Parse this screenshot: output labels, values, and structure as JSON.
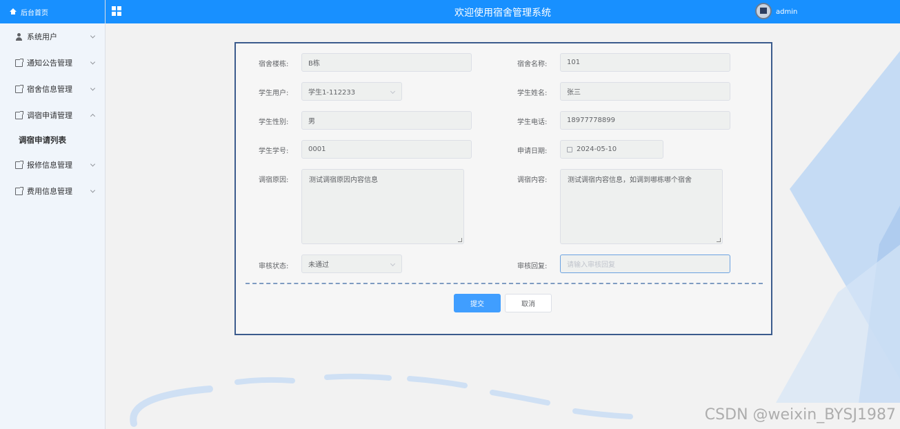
{
  "header": {
    "title": "欢迎使用宿舍管理系统",
    "username": "admin"
  },
  "sidebar": {
    "home": "后台首页",
    "items": [
      {
        "label": "系统用户",
        "icon": "user-icon",
        "expanded": false
      },
      {
        "label": "通知公告管理",
        "icon": "document-icon",
        "expanded": false
      },
      {
        "label": "宿舍信息管理",
        "icon": "document-icon",
        "expanded": false
      },
      {
        "label": "调宿申请管理",
        "icon": "document-icon",
        "expanded": true
      },
      {
        "label": "报修信息管理",
        "icon": "document-icon",
        "expanded": false
      },
      {
        "label": "费用信息管理",
        "icon": "document-icon",
        "expanded": false
      }
    ],
    "submenu": {
      "label": "调宿申请列表"
    }
  },
  "form": {
    "building": {
      "label": "宿舍楼栋:",
      "value": "B栋"
    },
    "dorm_name": {
      "label": "宿舍名称:",
      "value": "101"
    },
    "student_user": {
      "label": "学生用户:",
      "value": "学生1-112233"
    },
    "student_name": {
      "label": "学生姓名:",
      "value": "张三"
    },
    "student_gender": {
      "label": "学生性别:",
      "value": "男"
    },
    "student_phone": {
      "label": "学生电话:",
      "value": "18977778899"
    },
    "student_id": {
      "label": "学生学号:",
      "value": "0001"
    },
    "apply_date": {
      "label": "申请日期:",
      "value": "2024-05-10"
    },
    "reason": {
      "label": "调宿原因:",
      "value": "测试调宿原因内容信息"
    },
    "content": {
      "label": "调宿内容:",
      "value": "测试调宿内容信息，如调到哪栋哪个宿舍"
    },
    "review_status": {
      "label": "审核状态:",
      "value": "未通过"
    },
    "review_reply": {
      "label": "审核回复:",
      "placeholder": "请输入审核回复"
    },
    "submit_label": "提交",
    "cancel_label": "取消"
  },
  "watermark": "CSDN @weixin_BYSJ1987",
  "colors": {
    "accent": "#1890ff",
    "primary_button": "#409eff",
    "card_border": "#3a5a8c"
  }
}
